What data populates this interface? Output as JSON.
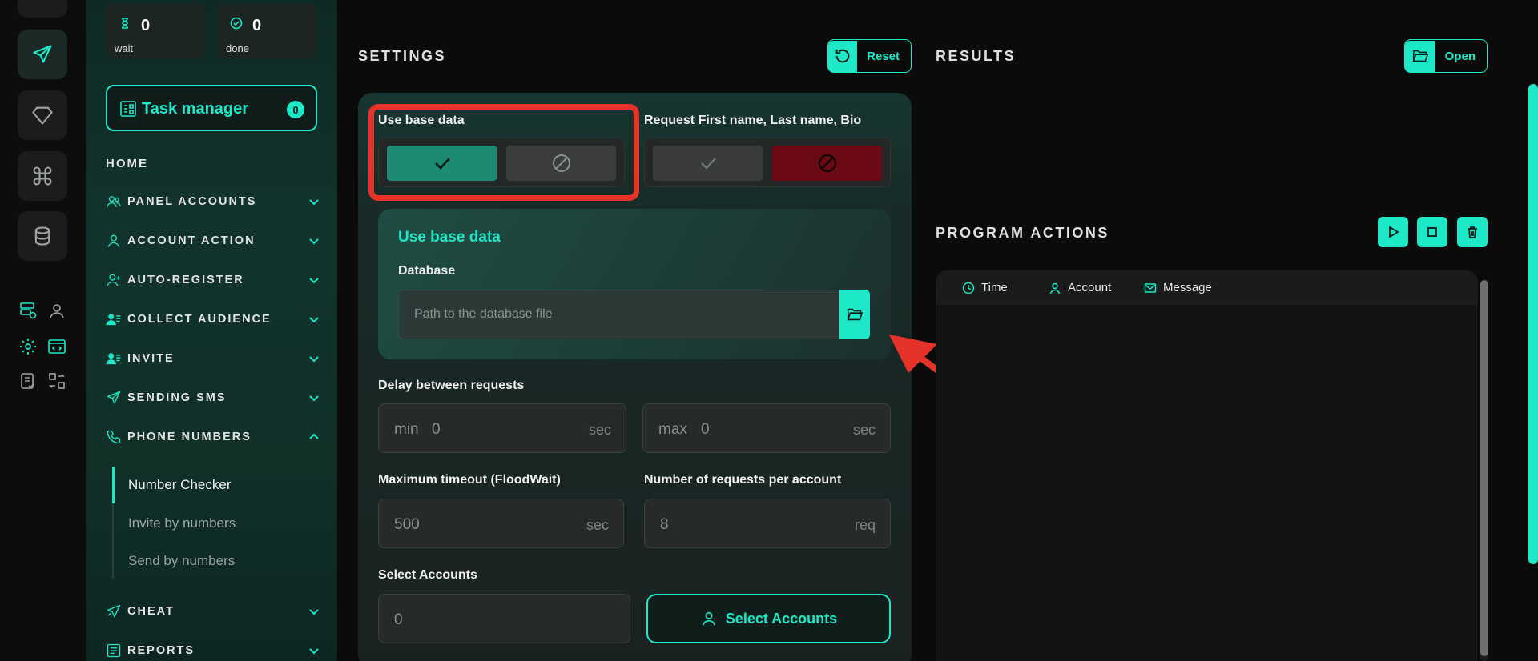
{
  "stats": {
    "wait": {
      "count": "0",
      "label": "wait"
    },
    "done": {
      "count": "0",
      "label": "done"
    }
  },
  "task_manager": {
    "label": "Task manager",
    "count": "0"
  },
  "nav": {
    "home": "HOME",
    "items": [
      {
        "label": "PANEL ACCOUNTS",
        "icon": "users-icon",
        "expanded": false
      },
      {
        "label": "ACCOUNT ACTION",
        "icon": "user-icon",
        "expanded": false
      },
      {
        "label": "AUTO-REGISTER",
        "icon": "user-plus-icon",
        "expanded": false
      },
      {
        "label": "COLLECT AUDIENCE",
        "icon": "user-list-icon",
        "expanded": false
      },
      {
        "label": "INVITE",
        "icon": "user-list-icon",
        "expanded": false
      },
      {
        "label": "SENDING SMS",
        "icon": "send-icon",
        "expanded": false
      },
      {
        "label": "PHONE NUMBERS",
        "icon": "phone-icon",
        "expanded": true
      },
      {
        "label": "CHEAT",
        "icon": "megaphone-icon",
        "expanded": false
      },
      {
        "label": "REPORTS",
        "icon": "report-icon",
        "expanded": false
      }
    ],
    "phone_sub": [
      "Number Checker",
      "Invite by numbers",
      "Send by numbers"
    ],
    "active_sub": "Number Checker"
  },
  "settings": {
    "title": "SETTINGS",
    "reset_label": "Reset",
    "use_base_data_label": "Use base data",
    "use_base_data_value": true,
    "request_names_label": "Request First name, Last name, Bio",
    "request_names_value": false,
    "base_card": {
      "title": "Use base data",
      "database_label": "Database",
      "database_placeholder": "Path to the database file"
    },
    "delay_label": "Delay between requests",
    "delay_min": {
      "prefix": "min",
      "value": "0",
      "unit": "sec"
    },
    "delay_max": {
      "prefix": "max",
      "value": "0",
      "unit": "sec"
    },
    "timeout_label": "Maximum timeout (FloodWait)",
    "timeout": {
      "value": "500",
      "unit": "sec"
    },
    "requests_label": "Number of requests per account",
    "requests": {
      "value": "8",
      "unit": "req"
    },
    "select_accounts_label": "Select Accounts",
    "select_accounts_value": "0",
    "select_accounts_button": "Select Accounts"
  },
  "results": {
    "title": "RESULTS",
    "open_label": "Open"
  },
  "program_actions": {
    "title": "PROGRAM ACTIONS",
    "columns": [
      "Time",
      "Account",
      "Message"
    ]
  },
  "colors": {
    "accent": "#1de9c8",
    "danger": "#6b0a14",
    "highlight": "#e5332a"
  }
}
